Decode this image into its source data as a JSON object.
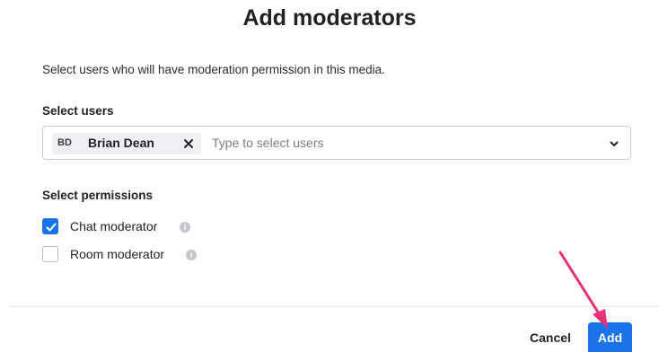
{
  "dialog": {
    "title": "Add moderators",
    "description": "Select users who will have moderation permission in this media."
  },
  "select_users": {
    "label": "Select users",
    "placeholder": "Type to select users",
    "selected": [
      {
        "initials": "BD",
        "name": "Brian Dean"
      }
    ]
  },
  "permissions": {
    "label": "Select permissions",
    "items": [
      {
        "label": "Chat moderator",
        "checked": true
      },
      {
        "label": "Room moderator",
        "checked": false
      }
    ]
  },
  "footer": {
    "cancel_label": "Cancel",
    "add_label": "Add"
  },
  "colors": {
    "primary": "#1a73e8",
    "annotation_arrow": "#e8307a"
  }
}
